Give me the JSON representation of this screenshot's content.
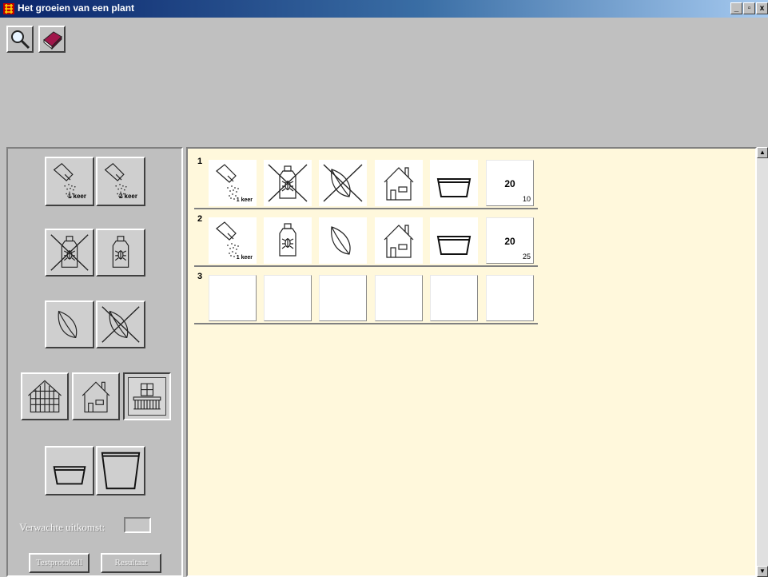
{
  "window": {
    "title": "Het groeien van een plant",
    "minimize": "_",
    "maximize": "▫",
    "close": "x"
  },
  "icons": {
    "search": "magnifier-icon",
    "book": "book-icon",
    "watering": "watering-can-icon",
    "spray": "spray-bottle-icon",
    "leaf": "leaf-icon",
    "greenhouse": "greenhouse-icon",
    "house": "house-icon",
    "balcony": "balcony-icon",
    "pot": "pot-icon"
  },
  "panel": {
    "water_once_label": "1 keer",
    "water_twice_label": "2 keer",
    "expected_label": "Verwachte uitkomst:",
    "expected_value": "",
    "test_button": "Testprotokoll",
    "result_button": "Resultaat"
  },
  "experiments": [
    {
      "number": "1",
      "water_label": "1 keer",
      "big_value": "20",
      "small_value": "10"
    },
    {
      "number": "2",
      "water_label": "1 keer",
      "big_value": "20",
      "small_value": "25"
    },
    {
      "number": "3"
    }
  ],
  "colors": {
    "workspace": "#fff8dc",
    "panel": "#bfbfbf",
    "title_start": "#0a246a",
    "title_end": "#a6caf0"
  }
}
